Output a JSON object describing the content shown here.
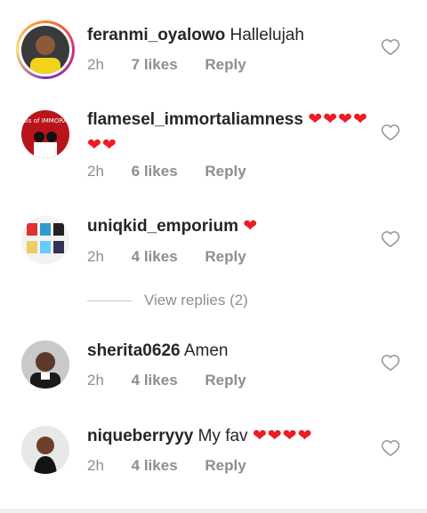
{
  "comments": [
    {
      "user": "feranmi_oyalowo",
      "text": "Hallelujah",
      "hearts": "",
      "time": "2h",
      "likes": "7 likes",
      "reply": "Reply"
    },
    {
      "user": "flamesel_immortaliamness",
      "text": "",
      "hearts": "❤❤❤❤❤❤",
      "time": "2h",
      "likes": "6 likes",
      "reply": "Reply"
    },
    {
      "user": "uniqkid_emporium",
      "text": "",
      "hearts": "❤",
      "time": "2h",
      "likes": "4 likes",
      "reply": "Reply"
    },
    {
      "user": "sherita0626",
      "text": "Amen",
      "hearts": "",
      "time": "2h",
      "likes": "4 likes",
      "reply": "Reply"
    },
    {
      "user": "niqueberryyy",
      "text": "My fav",
      "hearts": "❤❤❤❤",
      "time": "2h",
      "likes": "4 likes",
      "reply": "Reply"
    }
  ],
  "view_replies": "View replies (2)",
  "avatar_caption": "Portals of IMMORALITY",
  "icons": {
    "like": "heart-outline-icon",
    "reaction": "red-heart-emoji"
  },
  "colors": {
    "meta": "#8e8e8e",
    "heart": "#ed1c24",
    "ring_start": "#f58529",
    "ring_end": "#dd2a7b"
  }
}
